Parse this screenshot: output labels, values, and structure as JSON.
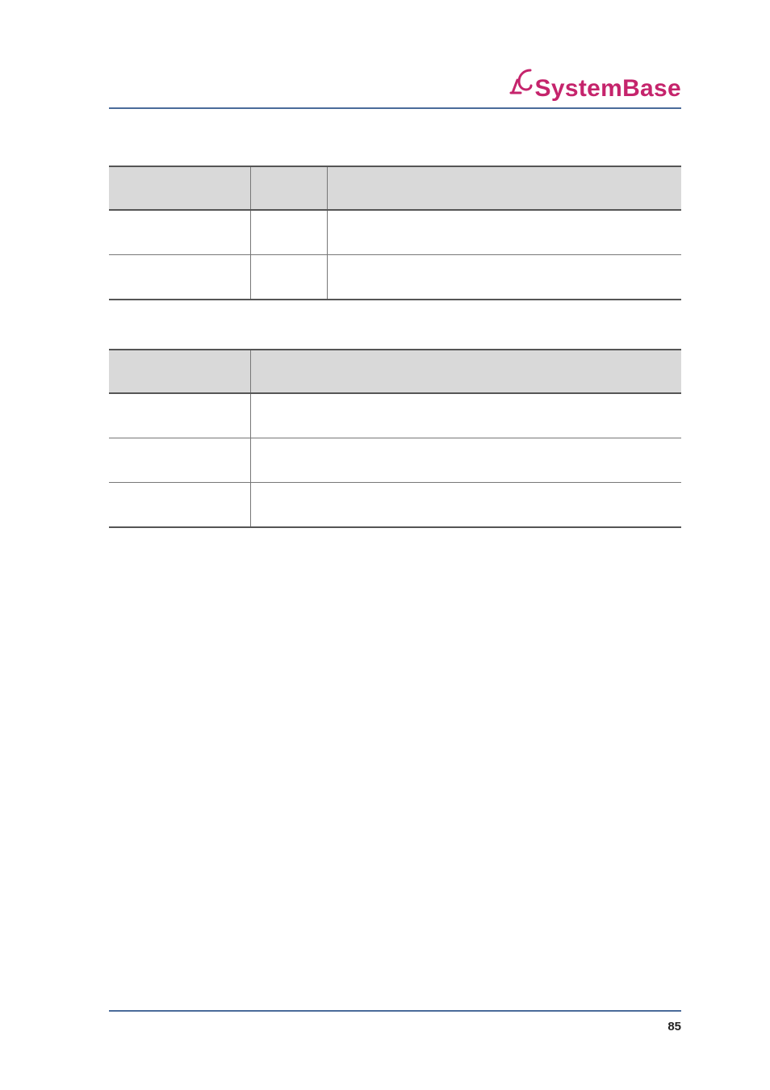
{
  "header": {
    "brand": "SystemBase"
  },
  "table1": {
    "headers": {
      "col1": "",
      "col2": "",
      "col3": ""
    },
    "rows": [
      {
        "col1": "",
        "col2": "",
        "col3": ""
      },
      {
        "col1": "",
        "col2": "",
        "col3": ""
      }
    ]
  },
  "table2": {
    "headers": {
      "col1": "",
      "col2": ""
    },
    "rows": [
      {
        "col1": "",
        "col2": ""
      },
      {
        "col1": "",
        "col2": ""
      },
      {
        "col1": "",
        "col2": ""
      }
    ]
  },
  "footer": {
    "page_number": "85"
  }
}
